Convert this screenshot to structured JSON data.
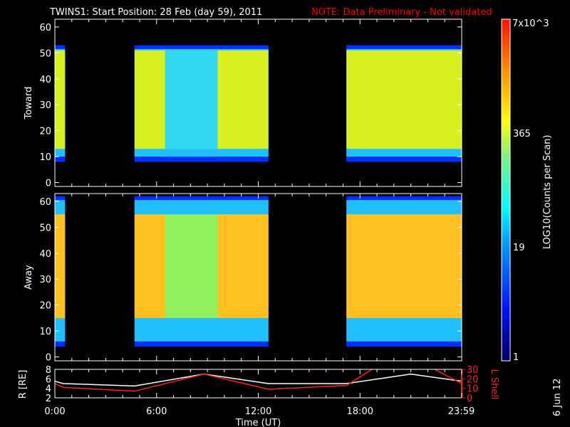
{
  "title": "TWINS1: Start Position: 28 Feb (day  59), 2011",
  "note": "NOTE: Data Preliminary - Not validated",
  "date_stamp": "6 Jun 12",
  "colors": {
    "note": "#ff0000",
    "lshell": "#ff2020",
    "radius": "#ffffff"
  },
  "chart_data": [
    {
      "type": "heatmap",
      "name": "Toward",
      "ylabel": "Toward",
      "ylim": [
        -1.5,
        63
      ],
      "yticks": [
        "0",
        "10",
        "20",
        "30",
        "40",
        "50",
        "60"
      ],
      "xlim": [
        0,
        24
      ],
      "data_intervals_hours": [
        [
          0,
          0.6
        ],
        [
          4.7,
          12.6
        ],
        [
          17.2,
          24
        ]
      ],
      "band": {
        "low": 8,
        "high": 53,
        "core_low": 13,
        "core_high": 51
      },
      "low_region_hours": [
        6.5,
        9.6
      ],
      "core_color": "#d8f020",
      "low_color": "#30d8f0"
    },
    {
      "type": "heatmap",
      "name": "Away",
      "ylabel": "Away",
      "ylim": [
        -1.5,
        63
      ],
      "yticks": [
        "0",
        "10",
        "20",
        "30",
        "40",
        "50",
        "60"
      ],
      "xlim": [
        0,
        24
      ],
      "data_intervals_hours": [
        [
          0,
          0.6
        ],
        [
          4.7,
          12.6
        ],
        [
          17.2,
          24
        ]
      ],
      "band": {
        "low": 4,
        "high": 62,
        "core_low": 15,
        "core_high": 55
      },
      "low_region_hours": [
        6.5,
        9.6
      ],
      "core_color": "#ffc020",
      "low_color": "#90f060"
    },
    {
      "type": "line",
      "xlabel": "Time (UT)",
      "xticks": [
        {
          "h": 0,
          "label": "0:00"
        },
        {
          "h": 6,
          "label": "6:00"
        },
        {
          "h": 12,
          "label": "12:00"
        },
        {
          "h": 18,
          "label": "18:00"
        },
        {
          "h": 23.98,
          "label": "23:59"
        }
      ],
      "ylabel_left": "R [RE]",
      "ylim_left": [
        2,
        8
      ],
      "yticks_left": [
        "2",
        "4",
        "6",
        "8"
      ],
      "ylabel_right": "L Shell",
      "ylim_right": [
        0,
        30
      ],
      "yticks_right": [
        "0",
        "10",
        "20",
        "30"
      ],
      "series": [
        {
          "name": "R",
          "axis": "left",
          "x": [
            0,
            0.5,
            4.7,
            8.8,
            12.6,
            17.2,
            21,
            24
          ],
          "y": [
            5.5,
            5,
            4.5,
            7,
            5,
            5,
            7,
            5.5
          ]
        },
        {
          "name": "L Shell",
          "axis": "right",
          "x": [
            0,
            0.5,
            4.7,
            8.8,
            12.6,
            17.2,
            18.8,
            22.3,
            24
          ],
          "y": [
            15,
            11,
            7,
            25,
            9,
            13,
            31,
            31,
            15
          ]
        }
      ]
    }
  ],
  "colorbar": {
    "label": "LOG10(Counts per Scan)",
    "ticks": [
      "1",
      "19",
      "365",
      "7x10^3"
    ],
    "tick_display": {
      "top": "7x10",
      "top_exp": "3",
      "mid_hi": "365",
      "mid_lo": "19",
      "bottom": "1"
    }
  }
}
